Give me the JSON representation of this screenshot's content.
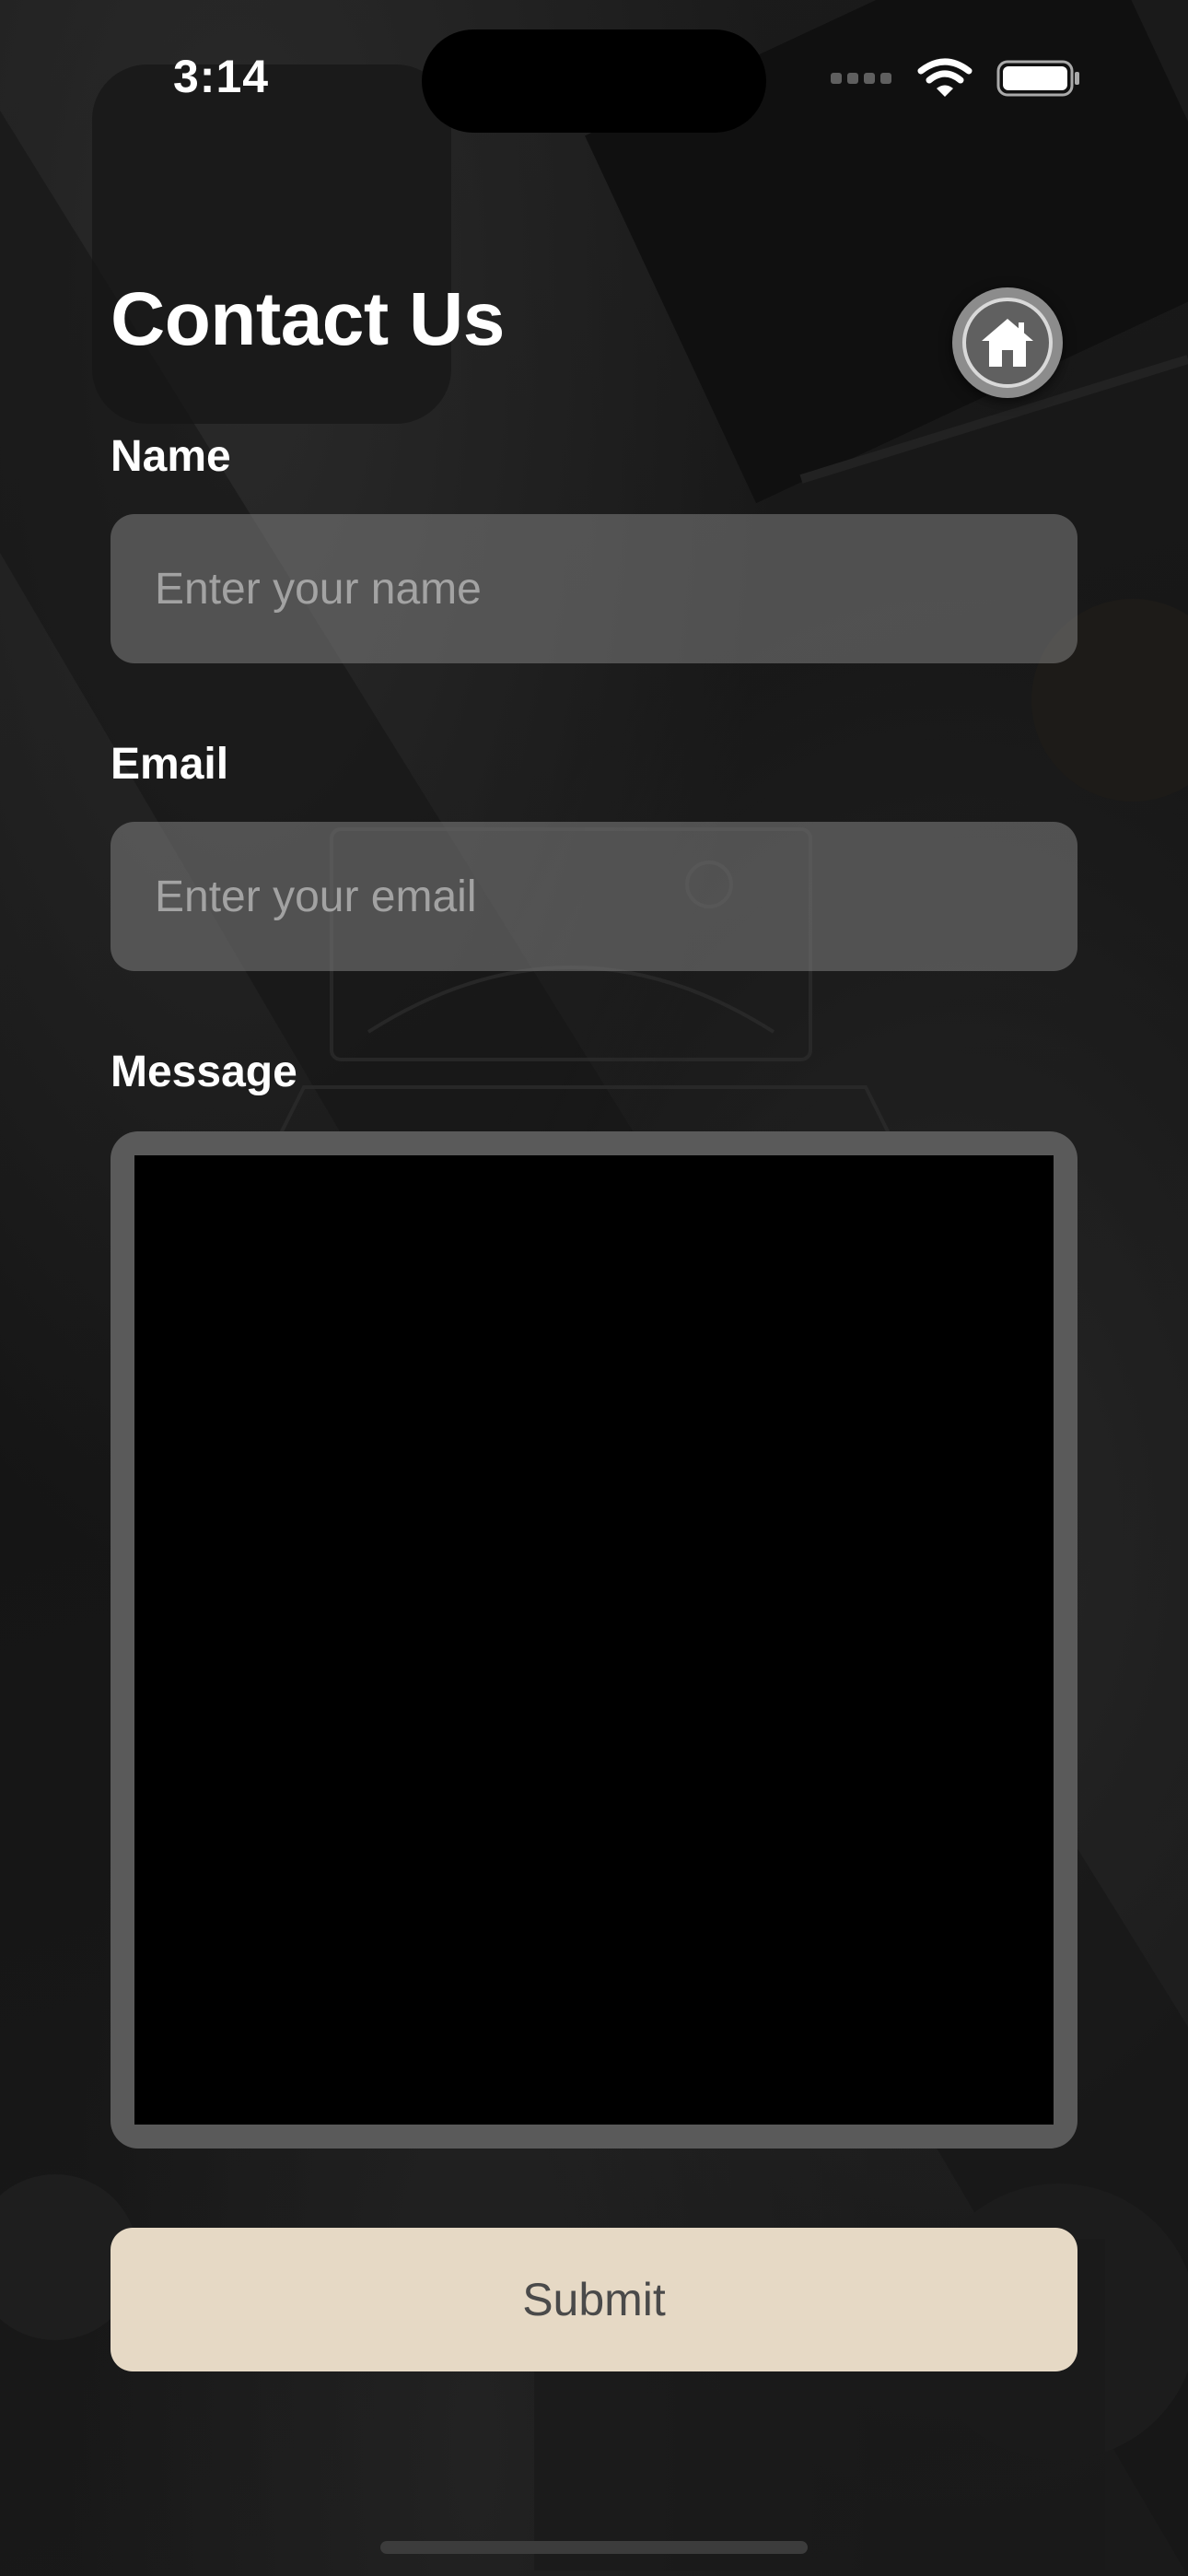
{
  "status_bar": {
    "time": "3:14",
    "signal_icon": "cellular-dots-icon",
    "wifi_icon": "wifi-icon",
    "battery_icon": "battery-icon"
  },
  "header": {
    "title": "Contact Us",
    "home_icon": "home-icon"
  },
  "form": {
    "name": {
      "label": "Name",
      "value": "",
      "placeholder": "Enter your name"
    },
    "email": {
      "label": "Email",
      "value": "",
      "placeholder": "Enter your email"
    },
    "message": {
      "label": "Message",
      "value": ""
    },
    "submit_label": "Submit"
  },
  "colors": {
    "submit_background": "#e6d9c5",
    "submit_text": "#4a4a4a",
    "input_background": "#6e6e6e",
    "message_frame": "#5a5a5a"
  }
}
